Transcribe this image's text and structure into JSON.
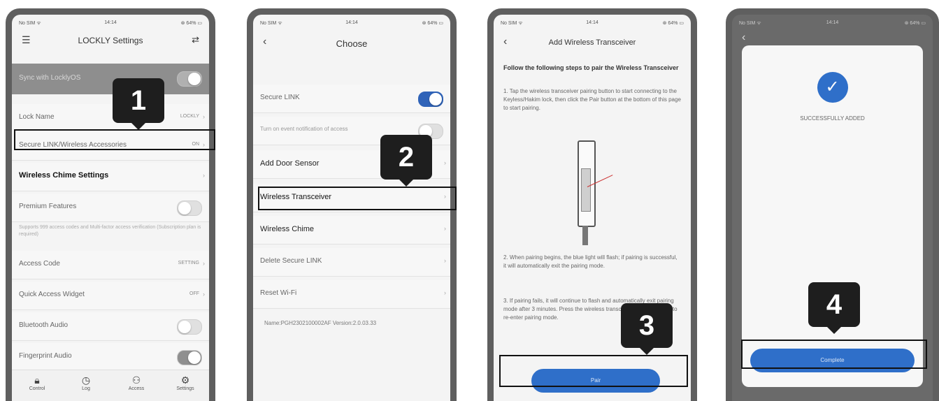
{
  "panel1": {
    "status": {
      "left": "No SIM ᯤ",
      "time": "14:14",
      "right": "⊛ 64% ▭"
    },
    "title": "LOCKLY Settings",
    "sync_label": "Sync with LocklyOS",
    "lock_name_label": "Lock Name",
    "lock_name_value": "LOCKLY",
    "secure_link_label": "Secure LINK/Wireless Accessories",
    "secure_link_value": "ON",
    "chime_label": "Wireless Chime Settings",
    "premium_label": "Premium Features",
    "premium_note": "Supports 999 access codes and Multi-factor access verification (Subscription plan is required)",
    "access_code_label": "Access Code",
    "access_code_value": "SETTING",
    "widget_label": "Quick Access Widget",
    "widget_value": "OFF",
    "bt_audio_label": "Bluetooth Audio",
    "fp_audio_label": "Fingerprint Audio",
    "tabs": [
      {
        "label": "Control"
      },
      {
        "label": "Log"
      },
      {
        "label": "Access"
      },
      {
        "label": "Settings"
      }
    ],
    "callout": "1"
  },
  "panel2": {
    "status": {
      "left": "No SIM ᯤ",
      "time": "14:14",
      "right": "⊛ 64% ▭"
    },
    "title": "Choose",
    "secure_link_label": "Secure LINK",
    "notification_label": "Turn on event notification of access",
    "door_sensor_label": "Add Door Sensor",
    "transceiver_label": "Wireless Transceiver",
    "chime_label": "Wireless Chime",
    "delete_label": "Delete Secure LINK",
    "reset_label": "Reset Wi-Fi",
    "name_version": "Name:PGH2302100002AF  Version:2.0.03.33",
    "callout": "2"
  },
  "panel3": {
    "status": {
      "left": "No SIM ᯤ",
      "time": "14:14",
      "right": "⊛ 64% ▭"
    },
    "title": "Add Wireless Transceiver",
    "heading": "Follow the following steps to pair the Wireless Transceiver",
    "step1": "1. Tap the wireless transceiver pairing button to start connecting to the Keyless/Hakim lock, then click the Pair button at the bottom of this page to start pairing.",
    "step2": "2. When pairing begins, the blue light will flash; if pairing is successful, it will automatically exit the pairing mode.",
    "step3": "3. If pairing fails, it will continue to flash and automatically exit pairing mode after 3 minutes. Press the wireless transceiver again to return to re-enter pairing mode.",
    "pair_button": "Pair",
    "callout": "3"
  },
  "panel4": {
    "status": {
      "left": "No SIM ᯤ",
      "time": "14:14",
      "right": "⊛ 64% ▭"
    },
    "success_text": "SUCCESSFULLY ADDED",
    "complete_button": "Complete",
    "callout": "4"
  }
}
